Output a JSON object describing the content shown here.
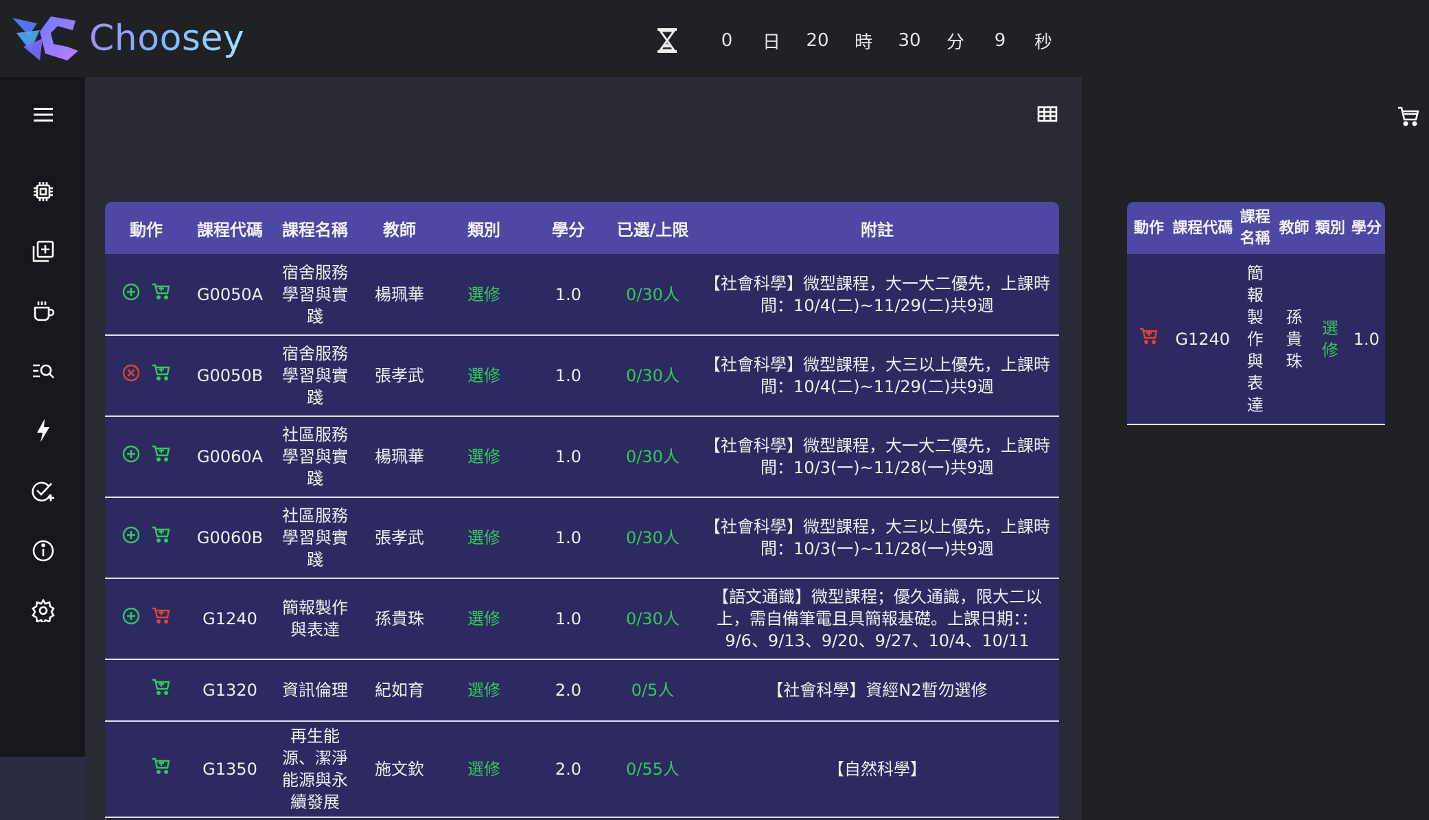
{
  "app": {
    "name": "Choosey"
  },
  "timer": {
    "days": "0",
    "day_unit": "日",
    "hours": "20",
    "hour_unit": "時",
    "minutes": "30",
    "minute_unit": "分",
    "seconds": "9",
    "second_unit": "秒"
  },
  "table": {
    "headers": {
      "action": "動作",
      "code": "課程代碼",
      "name": "課程名稱",
      "teacher": "教師",
      "type": "類別",
      "credit": "學分",
      "enrolled": "已選/上限",
      "note": "附註"
    },
    "rows": [
      {
        "code": "G0050A",
        "name": "宿舍服務學習與實踐",
        "teacher": "楊珮華",
        "type": "選修",
        "credit": "1.0",
        "enrolled": "0/30人",
        "note": "【社會科學】微型課程，大一大二優先，上課時間：10/4(二)~11/29(二)共9週",
        "action": "add",
        "cart": "green"
      },
      {
        "code": "G0050B",
        "name": "宿舍服務學習與實踐",
        "teacher": "張孝武",
        "type": "選修",
        "credit": "1.0",
        "enrolled": "0/30人",
        "note": "【社會科學】微型課程，大三以上優先，上課時間：10/4(二)~11/29(二)共9週",
        "action": "remove",
        "cart": "green"
      },
      {
        "code": "G0060A",
        "name": "社區服務學習與實踐",
        "teacher": "楊珮華",
        "type": "選修",
        "credit": "1.0",
        "enrolled": "0/30人",
        "note": "【社會科學】微型課程，大一大二優先，上課時間：10/3(一)~11/28(一)共9週",
        "action": "add",
        "cart": "green"
      },
      {
        "code": "G0060B",
        "name": "社區服務學習與實踐",
        "teacher": "張孝武",
        "type": "選修",
        "credit": "1.0",
        "enrolled": "0/30人",
        "note": "【社會科學】微型課程，大三以上優先，上課時間：10/3(一)~11/28(一)共9週",
        "action": "add",
        "cart": "green"
      },
      {
        "code": "G1240",
        "name": "簡報製作與表達",
        "teacher": "孫貴珠",
        "type": "選修",
        "credit": "1.0",
        "enrolled": "0/30人",
        "note": "【語文通識】微型課程；優久通識，限大二以上，需自備筆電且具簡報基礎。上課日期：：9/6、9/13、9/20、9/27、10/4、10/11",
        "action": "add",
        "cart": "red"
      },
      {
        "code": "G1320",
        "name": "資訊倫理",
        "teacher": "紀如育",
        "type": "選修",
        "credit": "2.0",
        "enrolled": "0/5人",
        "note": "【社會科學】資經N2暫勿選修",
        "action": "none",
        "cart": "green"
      },
      {
        "code": "G1350",
        "name": "再生能源、潔淨能源與永續發展",
        "teacher": "施文欽",
        "type": "選修",
        "credit": "2.0",
        "enrolled": "0/55人",
        "note": "【自然科學】",
        "action": "none",
        "cart": "green"
      }
    ]
  },
  "cart": {
    "headers": {
      "action": "動作",
      "code": "課程代碼",
      "name": "課程名稱",
      "teacher": "教師",
      "type": "類別",
      "credit": "學分"
    },
    "rows": [
      {
        "code": "G1240",
        "name": "簡報製作與表達",
        "teacher": "孫貴珠",
        "type": "選修",
        "credit": "1.0"
      }
    ]
  },
  "colors": {
    "accent": "#4c48a4",
    "row_bg": "#2c2a60",
    "green": "#35c85a",
    "red": "#e0452f"
  },
  "icons": {
    "menu": "menu-icon",
    "view": "grid-icon",
    "cart": "cart-icon"
  }
}
